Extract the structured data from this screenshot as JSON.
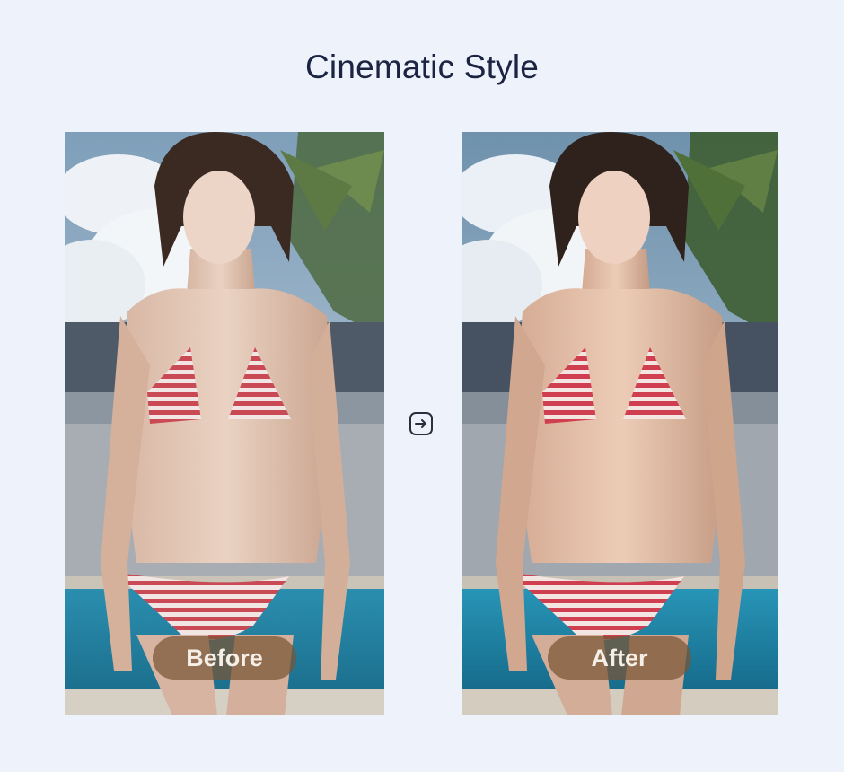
{
  "page": {
    "title": "Cinematic Style"
  },
  "comparison": {
    "before_label": "Before",
    "after_label": "After",
    "arrow_icon": "arrow-right-into-box-icon"
  },
  "colors": {
    "background": "#eef2fb",
    "title": "#1b2442",
    "label_pill": "#7a5434",
    "label_text": "#f5efe8",
    "arrow": "#2a2f3d"
  }
}
